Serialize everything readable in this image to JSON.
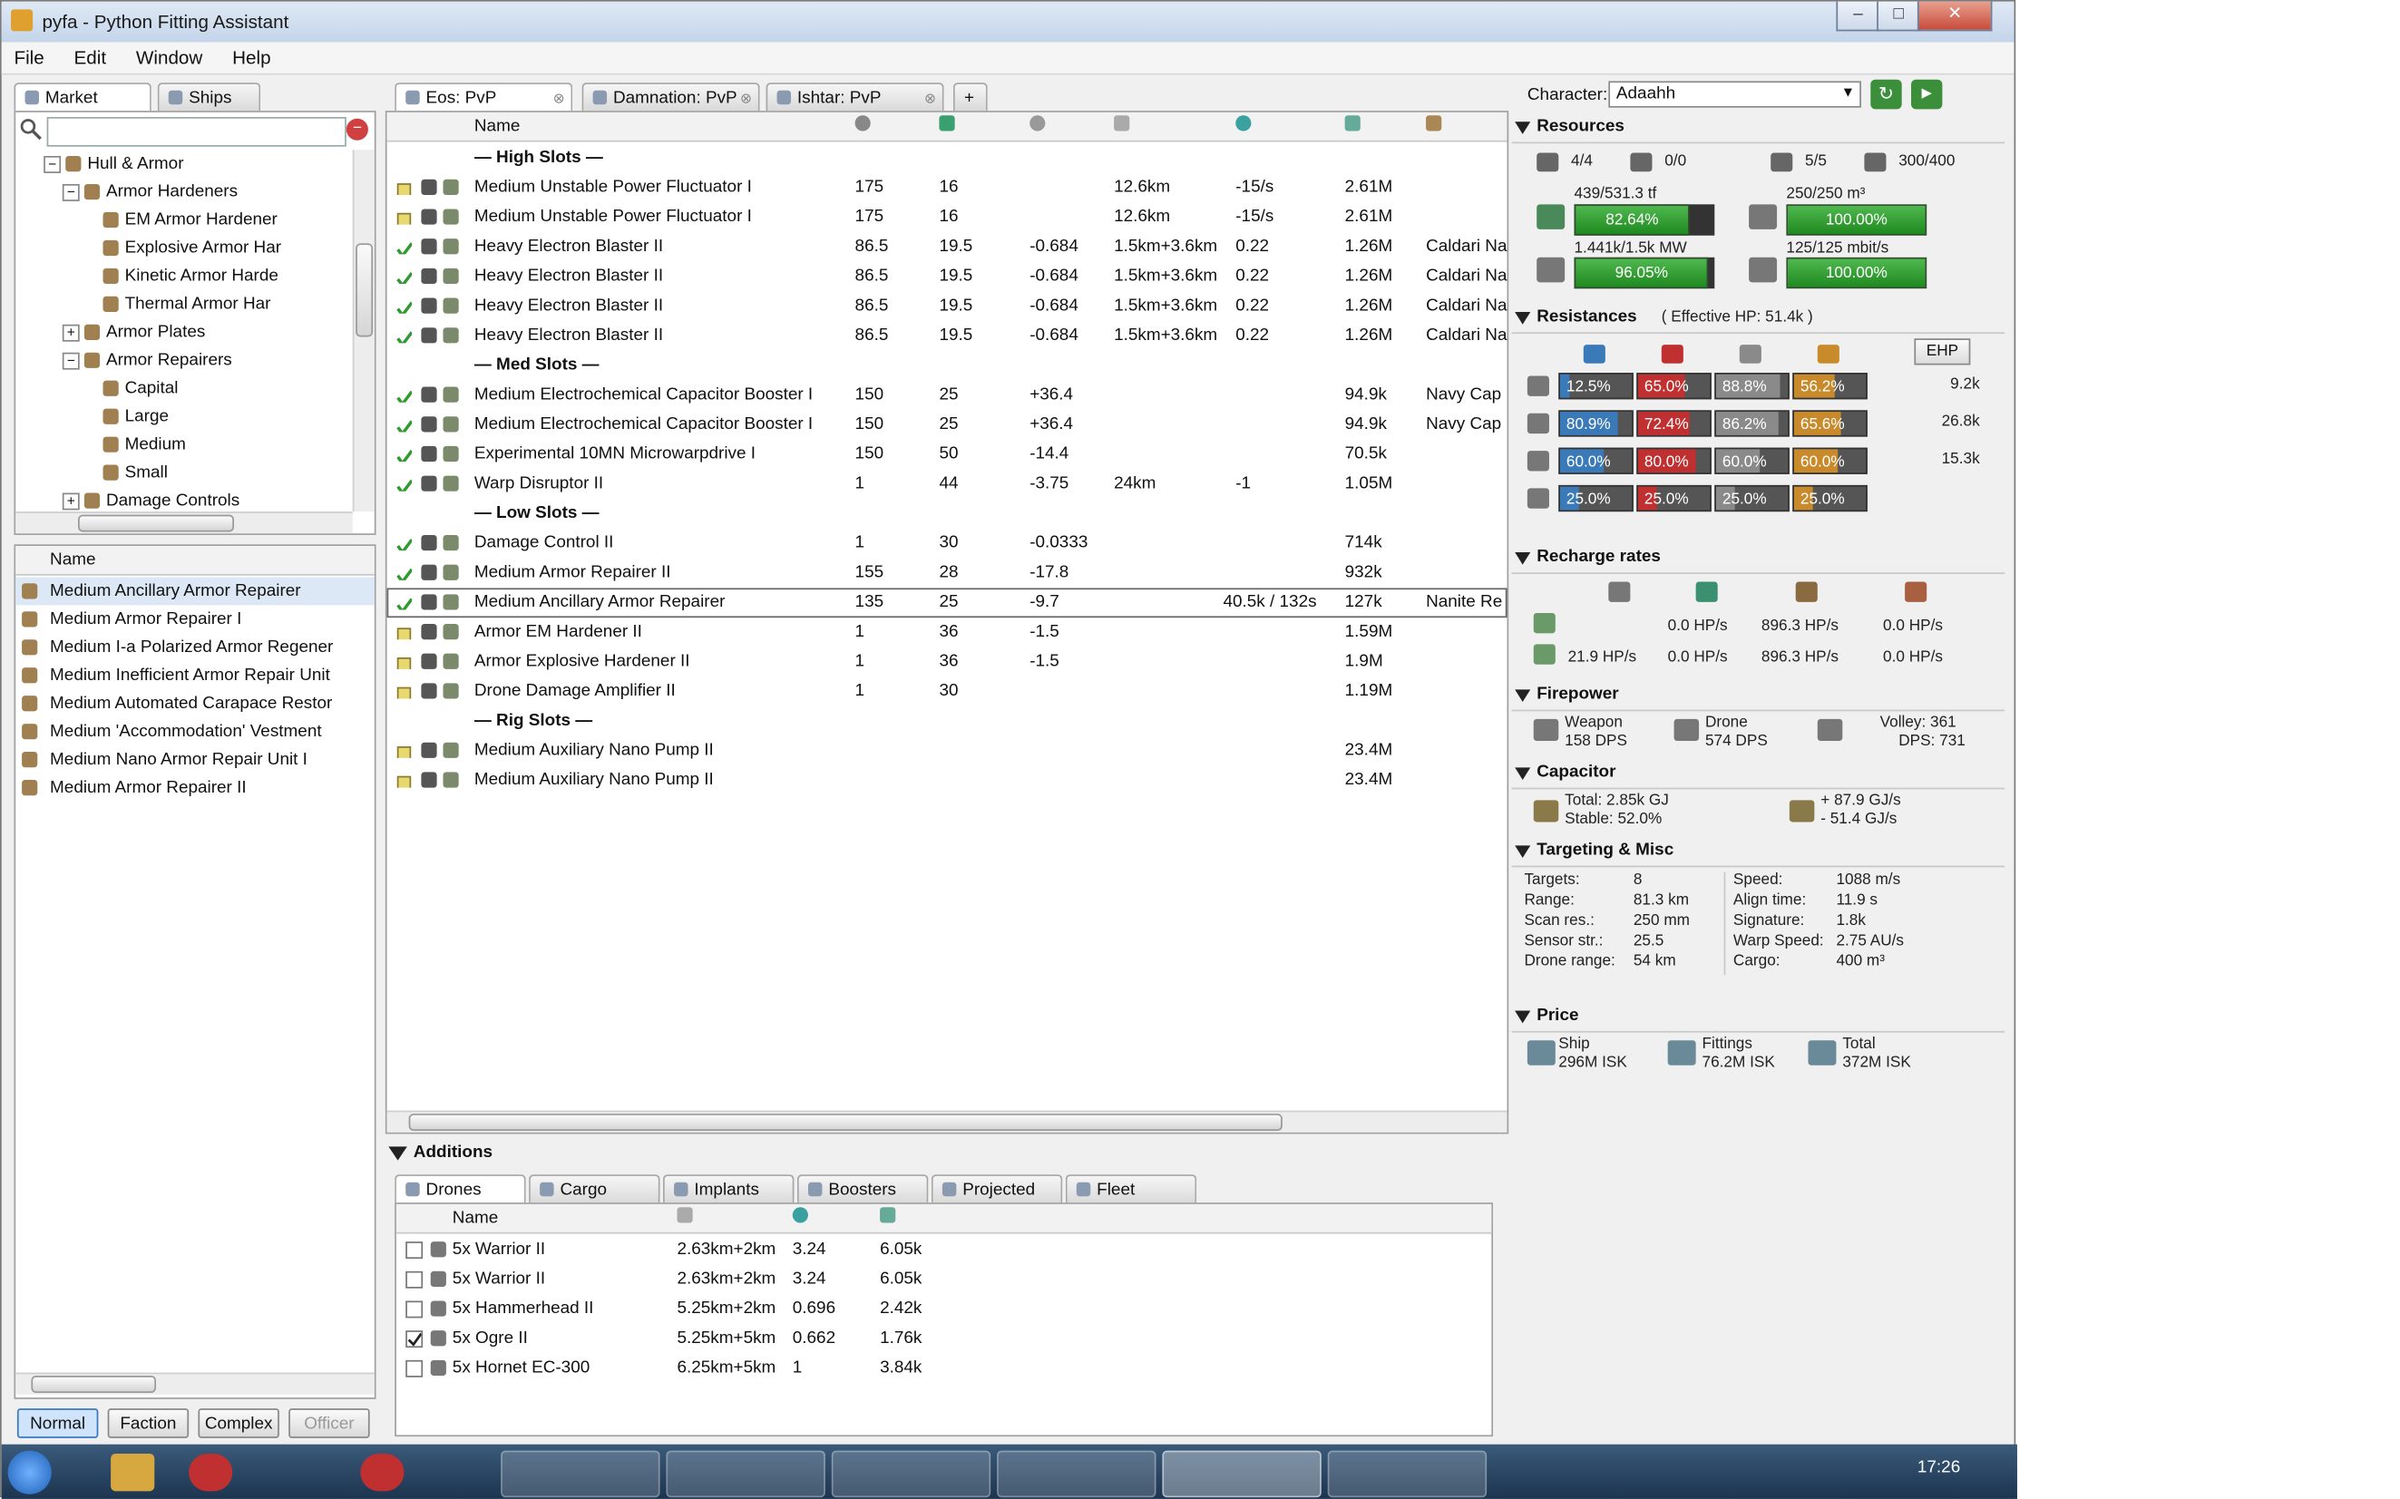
{
  "window": {
    "title": "pyfa - Python Fitting Assistant",
    "min_label": "–",
    "max_label": "□",
    "close_label": "✕"
  },
  "menu": [
    "File",
    "Edit",
    "Window",
    "Help"
  ],
  "left_tabs": [
    {
      "label": "Market",
      "icon": "market-icon"
    },
    {
      "label": "Ships",
      "icon": "ship-icon"
    }
  ],
  "search": {
    "placeholder": ""
  },
  "market_tree": [
    {
      "label": "Hull & Armor",
      "indent": 1,
      "expander": "−"
    },
    {
      "label": "Armor Hardeners",
      "indent": 2,
      "expander": "−"
    },
    {
      "label": "EM Armor Hardener",
      "indent": 3,
      "expander": ""
    },
    {
      "label": "Explosive Armor Har",
      "indent": 3,
      "expander": ""
    },
    {
      "label": "Kinetic Armor Harde",
      "indent": 3,
      "expander": ""
    },
    {
      "label": "Thermal Armor Har",
      "indent": 3,
      "expander": ""
    },
    {
      "label": "Armor Plates",
      "indent": 2,
      "expander": "+"
    },
    {
      "label": "Armor Repairers",
      "indent": 2,
      "expander": "−"
    },
    {
      "label": "Capital",
      "indent": 3,
      "expander": ""
    },
    {
      "label": "Large",
      "indent": 3,
      "expander": ""
    },
    {
      "label": "Medium",
      "indent": 3,
      "expander": ""
    },
    {
      "label": "Small",
      "indent": 3,
      "expander": ""
    },
    {
      "label": "Damage Controls",
      "indent": 2,
      "expander": "+"
    }
  ],
  "item_list_header": "Name",
  "item_list": [
    "Medium Ancillary Armor Repairer",
    "Medium Armor Repairer I",
    "Medium I-a Polarized Armor Regener",
    "Medium Inefficient Armor Repair Unit",
    "Medium Automated Carapace Restor",
    "Medium 'Accommodation' Vestment",
    "Medium Nano Armor Repair Unit I",
    "Medium Armor Repairer II"
  ],
  "meta_buttons": [
    "Normal",
    "Faction",
    "Complex",
    "Officer"
  ],
  "fit_tabs": [
    "Eos: PvP",
    "Damnation: PvP",
    "Ishtar: PvP"
  ],
  "fit_columns": {
    "name": "Name"
  },
  "fit_rows": [
    {
      "type": "header",
      "name": "— High Slots —"
    },
    {
      "type": "mod",
      "state": "off",
      "name": "Medium Unstable Power Fluctuator I",
      "cpu": "175",
      "pg": "16",
      "cap": "",
      "range": "12.6km",
      "opt": "-15/s",
      "misc": "",
      "price": "2.61M",
      "ammo": ""
    },
    {
      "type": "mod",
      "state": "off",
      "name": "Medium Unstable Power Fluctuator I",
      "cpu": "175",
      "pg": "16",
      "cap": "",
      "range": "12.6km",
      "opt": "-15/s",
      "misc": "",
      "price": "2.61M",
      "ammo": ""
    },
    {
      "type": "mod",
      "state": "on",
      "name": "Heavy Electron Blaster II",
      "cpu": "86.5",
      "pg": "19.5",
      "cap": "-0.684",
      "range": "1.5km+3.6km",
      "opt": "0.22",
      "misc": "",
      "price": "1.26M",
      "ammo": "Caldari Na"
    },
    {
      "type": "mod",
      "state": "on",
      "name": "Heavy Electron Blaster II",
      "cpu": "86.5",
      "pg": "19.5",
      "cap": "-0.684",
      "range": "1.5km+3.6km",
      "opt": "0.22",
      "misc": "",
      "price": "1.26M",
      "ammo": "Caldari Na"
    },
    {
      "type": "mod",
      "state": "on",
      "name": "Heavy Electron Blaster II",
      "cpu": "86.5",
      "pg": "19.5",
      "cap": "-0.684",
      "range": "1.5km+3.6km",
      "opt": "0.22",
      "misc": "",
      "price": "1.26M",
      "ammo": "Caldari Na"
    },
    {
      "type": "mod",
      "state": "on",
      "name": "Heavy Electron Blaster II",
      "cpu": "86.5",
      "pg": "19.5",
      "cap": "-0.684",
      "range": "1.5km+3.6km",
      "opt": "0.22",
      "misc": "",
      "price": "1.26M",
      "ammo": "Caldari Na"
    },
    {
      "type": "header",
      "name": "— Med Slots —"
    },
    {
      "type": "mod",
      "state": "on",
      "name": "Medium Electrochemical Capacitor Booster I",
      "cpu": "150",
      "pg": "25",
      "cap": "+36.4",
      "range": "",
      "opt": "",
      "misc": "",
      "price": "94.9k",
      "ammo": "Navy Cap"
    },
    {
      "type": "mod",
      "state": "on",
      "name": "Medium Electrochemical Capacitor Booster I",
      "cpu": "150",
      "pg": "25",
      "cap": "+36.4",
      "range": "",
      "opt": "",
      "misc": "",
      "price": "94.9k",
      "ammo": "Navy Cap"
    },
    {
      "type": "mod",
      "state": "on",
      "name": "Experimental 10MN Microwarpdrive I",
      "cpu": "150",
      "pg": "50",
      "cap": "-14.4",
      "range": "",
      "opt": "",
      "misc": "",
      "price": "70.5k",
      "ammo": ""
    },
    {
      "type": "mod",
      "state": "on",
      "name": "Warp Disruptor II",
      "cpu": "1",
      "pg": "44",
      "cap": "-3.75",
      "range": "24km",
      "opt": "-1",
      "misc": "",
      "price": "1.05M",
      "ammo": ""
    },
    {
      "type": "header",
      "name": "— Low Slots —"
    },
    {
      "type": "mod",
      "state": "on",
      "name": "Damage Control II",
      "cpu": "1",
      "pg": "30",
      "cap": "-0.0333",
      "range": "",
      "opt": "",
      "misc": "",
      "price": "714k",
      "ammo": ""
    },
    {
      "type": "mod",
      "state": "on",
      "name": "Medium Armor Repairer II",
      "cpu": "155",
      "pg": "28",
      "cap": "-17.8",
      "range": "",
      "opt": "",
      "misc": "",
      "price": "932k",
      "ammo": ""
    },
    {
      "type": "mod",
      "state": "on",
      "selected": true,
      "name": "Medium Ancillary Armor Repairer",
      "cpu": "135",
      "pg": "25",
      "cap": "-9.7",
      "range": "",
      "opt": "",
      "misc": "40.5k / 132s",
      "price": "127k",
      "ammo": "Nanite Re"
    },
    {
      "type": "mod",
      "state": "off",
      "name": "Armor EM Hardener II",
      "cpu": "1",
      "pg": "36",
      "cap": "-1.5",
      "range": "",
      "opt": "",
      "misc": "",
      "price": "1.59M",
      "ammo": ""
    },
    {
      "type": "mod",
      "state": "off",
      "name": "Armor Explosive Hardener II",
      "cpu": "1",
      "pg": "36",
      "cap": "-1.5",
      "range": "",
      "opt": "",
      "misc": "",
      "price": "1.9M",
      "ammo": ""
    },
    {
      "type": "mod",
      "state": "off",
      "name": "Drone Damage Amplifier II",
      "cpu": "1",
      "pg": "30",
      "cap": "",
      "range": "",
      "opt": "",
      "misc": "",
      "price": "1.19M",
      "ammo": ""
    },
    {
      "type": "header",
      "name": "— Rig Slots —"
    },
    {
      "type": "mod",
      "state": "off",
      "name": "Medium Auxiliary Nano Pump II",
      "cpu": "",
      "pg": "",
      "cap": "",
      "range": "",
      "opt": "",
      "misc": "",
      "price": "23.4M",
      "ammo": ""
    },
    {
      "type": "mod",
      "state": "off",
      "name": "Medium Auxiliary Nano Pump II",
      "cpu": "",
      "pg": "",
      "cap": "",
      "range": "",
      "opt": "",
      "misc": "",
      "price": "23.4M",
      "ammo": ""
    }
  ],
  "additions": {
    "title": "Additions",
    "tabs": [
      "Drones",
      "Cargo",
      "Implants",
      "Boosters",
      "Projected",
      "Fleet"
    ],
    "header": "Name",
    "rows": [
      {
        "checked": false,
        "name": "5x Warrior II",
        "range": "2.63km+2km",
        "bw": "3.24",
        "price": "6.05k"
      },
      {
        "checked": false,
        "name": "5x Warrior II",
        "range": "2.63km+2km",
        "bw": "3.24",
        "price": "6.05k"
      },
      {
        "checked": false,
        "name": "5x Hammerhead II",
        "range": "5.25km+2km",
        "bw": "0.696",
        "price": "2.42k"
      },
      {
        "checked": true,
        "name": "5x Ogre II",
        "range": "5.25km+5km",
        "bw": "0.662",
        "price": "1.76k"
      },
      {
        "checked": false,
        "name": "5x Hornet EC-300",
        "range": "6.25km+5km",
        "bw": "1",
        "price": "3.84k"
      }
    ]
  },
  "character": {
    "label": "Character:",
    "value": "Adaahh"
  },
  "resources": {
    "title": "Resources",
    "slots": [
      "4/4",
      "0/0",
      "5/5",
      "300/400"
    ],
    "cpu_text": "439/531.3 tf",
    "cpu_pct": "82.64%",
    "cpu_frac": 0.8264,
    "pg_text": "1.441k/1.5k MW",
    "pg_pct": "96.05%",
    "pg_frac": 0.9605,
    "drone_bay_text": "250/250 m³",
    "drone_bay_pct": "100.00%",
    "drone_bw_text": "125/125 mbit/s",
    "drone_bw_pct": "100.00%"
  },
  "resistances": {
    "title": "Resistances",
    "ehp_label": "( Effective HP: 51.4k )",
    "ehp_button": "EHP",
    "rows": [
      {
        "cells": [
          "12.5%",
          "65.0%",
          "88.8%",
          "56.2%"
        ],
        "fracs": [
          0.125,
          0.65,
          0.888,
          0.562
        ],
        "hp": "9.2k"
      },
      {
        "cells": [
          "80.9%",
          "72.4%",
          "86.2%",
          "65.6%"
        ],
        "fracs": [
          0.809,
          0.724,
          0.862,
          0.656
        ],
        "hp": "26.8k"
      },
      {
        "cells": [
          "60.0%",
          "80.0%",
          "60.0%",
          "60.0%"
        ],
        "fracs": [
          0.6,
          0.8,
          0.6,
          0.6
        ],
        "hp": "15.3k"
      },
      {
        "cells": [
          "25.0%",
          "25.0%",
          "25.0%",
          "25.0%"
        ],
        "fracs": [
          0.25,
          0.25,
          0.25,
          0.25
        ],
        "hp": ""
      }
    ],
    "colors": [
      "#3a7ab8",
      "#c03030",
      "#8a8a8a",
      "#c88a2a"
    ]
  },
  "recharge": {
    "title": "Recharge rates",
    "row1": [
      "0.0 HP/s",
      "896.3 HP/s",
      "0.0 HP/s"
    ],
    "row2": [
      "21.9 HP/s",
      "0.0 HP/s",
      "896.3 HP/s",
      "0.0 HP/s"
    ]
  },
  "firepower": {
    "title": "Firepower",
    "weapon_label": "Weapon",
    "weapon_dps": "158 DPS",
    "drone_label": "Drone",
    "drone_dps": "574 DPS",
    "volley": "Volley: 361",
    "dps": "DPS: 731"
  },
  "capacitor": {
    "title": "Capacitor",
    "total": "Total: 2.85k GJ",
    "stable": "Stable: 52.0%",
    "plus": "+ 87.9 GJ/s",
    "minus": "- 51.4 GJ/s"
  },
  "targeting": {
    "title": "Targeting & Misc",
    "left": [
      {
        "k": "Targets:",
        "v": "8"
      },
      {
        "k": "Range:",
        "v": "81.3 km"
      },
      {
        "k": "Scan res.:",
        "v": "250 mm"
      },
      {
        "k": "Sensor str.:",
        "v": "25.5"
      },
      {
        "k": "Drone range:",
        "v": "54 km"
      }
    ],
    "right": [
      {
        "k": "Speed:",
        "v": "1088 m/s"
      },
      {
        "k": "Align time:",
        "v": "11.9 s"
      },
      {
        "k": "Signature:",
        "v": "1.8k"
      },
      {
        "k": "Warp Speed:",
        "v": "2.75 AU/s"
      },
      {
        "k": "Cargo:",
        "v": "400 m³"
      }
    ]
  },
  "price": {
    "title": "Price",
    "ship_label": "Ship",
    "ship": "296M ISK",
    "fittings_label": "Fittings",
    "fittings": "76.2M ISK",
    "total_label": "Total",
    "total": "372M ISK"
  },
  "clock": "17:26",
  "colors": {
    "accent_green": "#2fa02f",
    "selected_row": "#ffffff",
    "header_bg": "#f0f0f0"
  }
}
